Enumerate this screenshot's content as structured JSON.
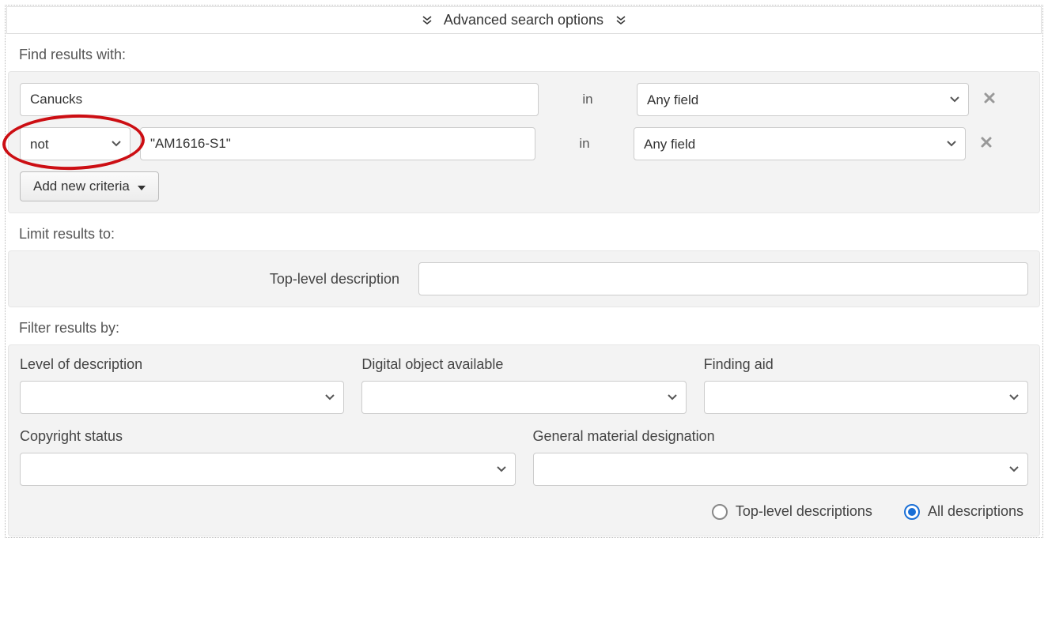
{
  "header": {
    "title": "Advanced search options"
  },
  "find": {
    "label": "Find results with:",
    "rows": [
      {
        "term": "Canucks",
        "in_label": "in",
        "field": "Any field"
      },
      {
        "operator": "not",
        "term": "\"AM1616-S1\"",
        "in_label": "in",
        "field": "Any field"
      }
    ],
    "add_button": "Add new criteria"
  },
  "limit": {
    "label": "Limit results to:",
    "field_label": "Top-level description",
    "value": ""
  },
  "filter": {
    "label": "Filter results by:",
    "level_of_description": {
      "label": "Level of description",
      "value": ""
    },
    "digital_object_available": {
      "label": "Digital object available",
      "value": ""
    },
    "finding_aid": {
      "label": "Finding aid",
      "value": ""
    },
    "copyright_status": {
      "label": "Copyright status",
      "value": ""
    },
    "general_material_designation": {
      "label": "General material designation",
      "value": ""
    },
    "radios": {
      "top_level": "Top-level descriptions",
      "all": "All descriptions",
      "selected": "all"
    }
  }
}
